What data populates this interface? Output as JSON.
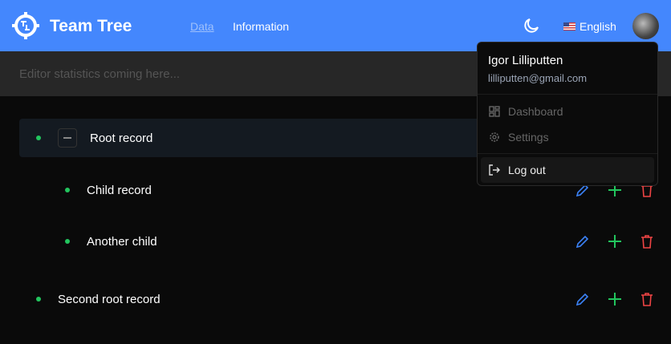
{
  "header": {
    "brand": "Team Tree",
    "nav": [
      {
        "label": "Data",
        "active": true
      },
      {
        "label": "Information",
        "active": false
      }
    ],
    "language": "English",
    "accent": "#4487fd"
  },
  "stats": {
    "text": "Editor statistics coming here..."
  },
  "tree": [
    {
      "label": "Root record",
      "level": 0,
      "expanded": true,
      "selected": true
    },
    {
      "label": "Child record",
      "level": 1
    },
    {
      "label": "Another child",
      "level": 1
    },
    {
      "label": "Second root record",
      "level": 0
    }
  ],
  "user_menu": {
    "name": "Igor Lilliputten",
    "email": "lilliputten@gmail.com",
    "items": [
      {
        "label": "Dashboard",
        "icon": "dashboard-icon"
      },
      {
        "label": "Settings",
        "icon": "gear-icon"
      },
      {
        "label": "Log out",
        "icon": "logout-icon",
        "highlighted": true
      }
    ]
  },
  "colors": {
    "edit": "#3b82f6",
    "add": "#22c55e",
    "delete": "#ef4444"
  }
}
